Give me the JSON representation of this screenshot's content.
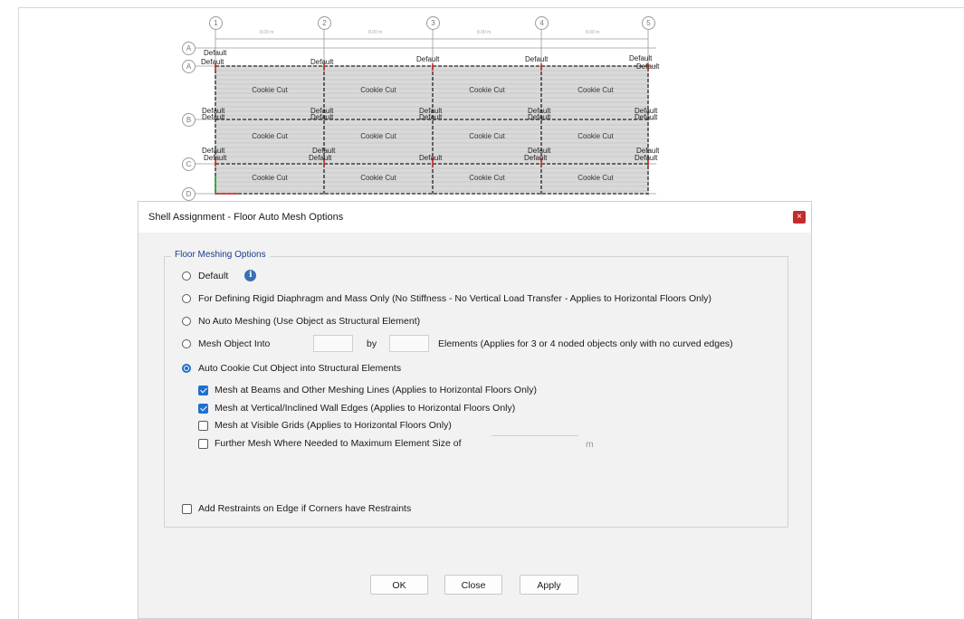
{
  "plan": {
    "grid_cols": [
      "1",
      "2",
      "3",
      "4",
      "5"
    ],
    "grid_rows": [
      "A",
      "A",
      "B",
      "C",
      "D"
    ],
    "cells": [
      "Cookie Cut",
      "Cookie Cut",
      "Cookie Cut",
      "Cookie Cut",
      "Cookie Cut",
      "Cookie Cut",
      "Cookie Cut",
      "Cookie Cut",
      "Cookie Cut",
      "Cookie Cut",
      "Cookie Cut",
      "Cookie Cut"
    ],
    "default_label": "Default",
    "span_label": "8.00 m"
  },
  "dialog": {
    "title": "Shell Assignment - Floor Auto Mesh Options",
    "close_glyph": "×",
    "group_title": "Floor Meshing Options",
    "info_glyph": "i",
    "options": {
      "default": "Default",
      "rigid": "For Defining Rigid Diaphragm and Mass Only  (No Stiffness - No Vertical Load Transfer - Applies to Horizontal Floors Only)",
      "no_auto": "No Auto Meshing  (Use Object as Structural Element)",
      "mesh_into": "Mesh Object Into",
      "by": "by",
      "elements_note": "Elements (Applies for 3 or 4 noded objects only with no curved edges)",
      "auto_cookie": "Auto Cookie Cut Object into Structural Elements"
    },
    "checks": {
      "beams": "Mesh at Beams and Other Meshing Lines  (Applies to Horizontal Floors Only)",
      "walls": "Mesh at Vertical/Inclined Wall Edges  (Applies to Horizontal Floors Only)",
      "grids": "Mesh at Visible Grids  (Applies to Horizontal Floors Only)",
      "further": "Further Mesh Where Needed to Maximum Element Size of",
      "unit": "m",
      "restraints": "Add Restraints on Edge if Corners have Restraints"
    },
    "buttons": {
      "ok": "OK",
      "close": "Close",
      "apply": "Apply"
    },
    "colors": {
      "accent": "#1e6fd0",
      "close_bg": "#c42b2b",
      "legend": "#1c3d8a"
    }
  }
}
